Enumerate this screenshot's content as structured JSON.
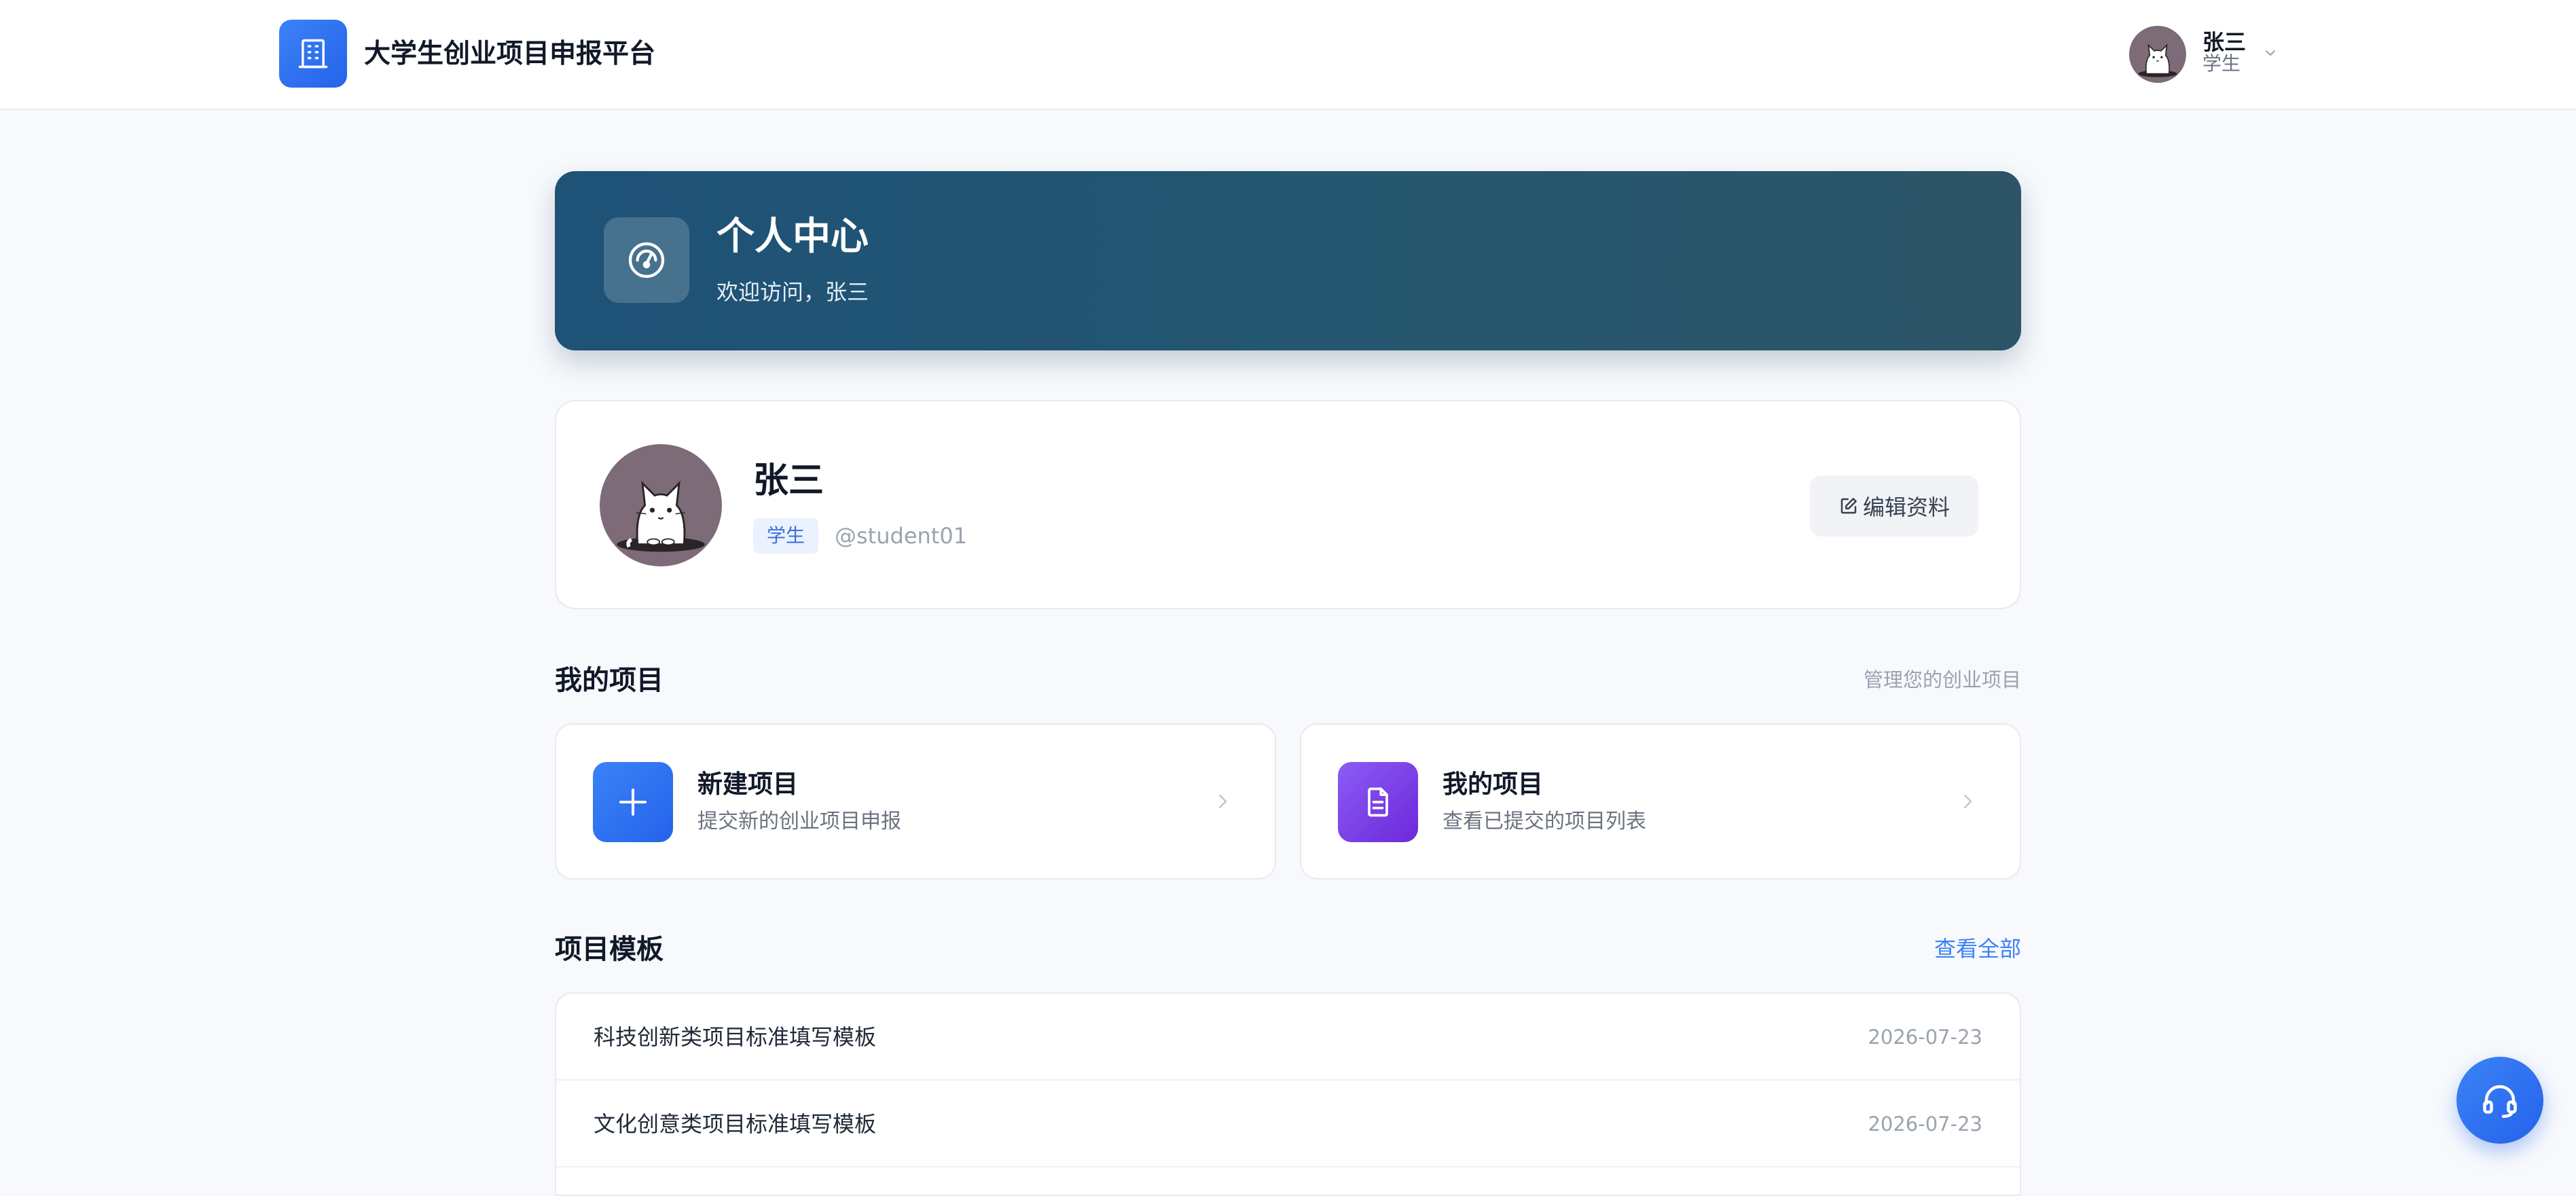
{
  "app": {
    "title": "大学生创业项目申报平台",
    "logo_icon": "building-icon",
    "accent_color": "#3b82f6"
  },
  "user_menu": {
    "name": "张三",
    "role": "学生",
    "avatar_icon": "cat-avatar-icon"
  },
  "banner": {
    "title": "个人中心",
    "subtitle": "欢迎访问，张三",
    "icon": "dashboard-gauge-icon",
    "color": "#1e5277"
  },
  "profile": {
    "name": "张三",
    "role_badge": "学生",
    "username": "@student01",
    "edit_label": "编辑资料"
  },
  "my_projects": {
    "title": "我的项目",
    "hint": "管理您的创业项目",
    "cards": [
      {
        "title": "新建项目",
        "desc": "提交新的创业项目申报",
        "icon": "plus-icon",
        "color": "#3b82f6"
      },
      {
        "title": "我的项目",
        "desc": "查看已提交的项目列表",
        "icon": "document-icon",
        "color": "#7c3aed"
      }
    ]
  },
  "templates": {
    "title": "项目模板",
    "view_all": "查看全部",
    "items": [
      {
        "name": "科技创新类项目标准填写模板",
        "date": "2026-07-23"
      },
      {
        "name": "文化创意类项目标准填写模板",
        "date": "2026-07-23"
      }
    ]
  },
  "support": {
    "icon": "headset-icon"
  }
}
